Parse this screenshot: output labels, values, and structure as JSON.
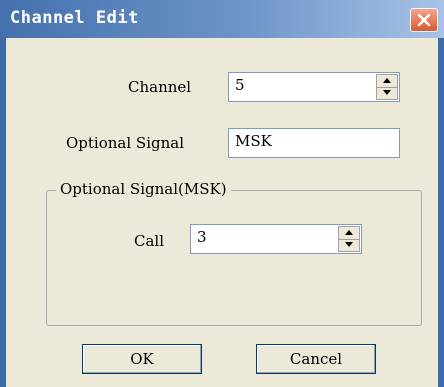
{
  "window": {
    "title": "Channel Edit"
  },
  "form": {
    "channel_label": "Channel",
    "channel_value": "5",
    "optional_signal_label": "Optional Signal",
    "optional_signal_value": "MSK"
  },
  "group": {
    "title": "Optional Signal(MSK)",
    "call_label": "Call",
    "call_value": "3"
  },
  "buttons": {
    "ok": "OK",
    "cancel": "Cancel"
  },
  "colors": {
    "titlebar": "#4470ad",
    "window_frame": "#3d6ba8",
    "dialog_bg": "#ece9d8",
    "close_button": "#d9592f"
  },
  "icons": {
    "close": "close-icon",
    "spin_up": "arrow-up-icon",
    "spin_down": "arrow-down-icon"
  }
}
